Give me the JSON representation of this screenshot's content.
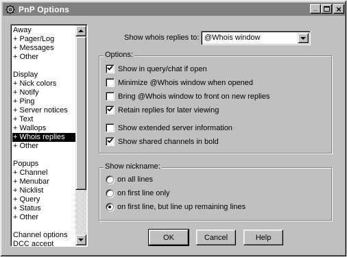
{
  "window": {
    "title": "PnP Options",
    "controls": {
      "minimize": "_",
      "maximize": "□",
      "close": "×"
    }
  },
  "sidebar": {
    "items": [
      {
        "label": "Away"
      },
      {
        "label": "+ Pager/Log"
      },
      {
        "label": "+ Messages"
      },
      {
        "label": "+ Other"
      },
      {
        "label": ""
      },
      {
        "label": "Display"
      },
      {
        "label": "+ Nick colors"
      },
      {
        "label": "+ Notify"
      },
      {
        "label": "+ Ping"
      },
      {
        "label": "+ Server notices"
      },
      {
        "label": "+ Text"
      },
      {
        "label": "+ Wallops"
      },
      {
        "label": "+ Whois replies",
        "selected": true
      },
      {
        "label": "+ Other"
      },
      {
        "label": ""
      },
      {
        "label": "Popups"
      },
      {
        "label": "+ Channel"
      },
      {
        "label": "+ Menubar"
      },
      {
        "label": "+ Nicklist"
      },
      {
        "label": "+ Query"
      },
      {
        "label": "+ Status"
      },
      {
        "label": "+ Other"
      },
      {
        "label": ""
      },
      {
        "label": "Channel options"
      },
      {
        "label": "DCC accept"
      }
    ]
  },
  "whois": {
    "show_label": "Show whois replies to:",
    "selected": "@Whois window"
  },
  "options": {
    "title": "Options:",
    "items": [
      {
        "label": "Show in query/chat if open",
        "checked": true
      },
      {
        "label": "Minimize @Whois window when opened",
        "checked": false
      },
      {
        "label": "Bring @Whois window to front on new replies",
        "checked": false
      },
      {
        "label": "Retain replies for later viewing",
        "checked": true
      },
      {
        "label": "Show extended server information",
        "checked": false
      },
      {
        "label": "Show shared channels in bold",
        "checked": true
      }
    ]
  },
  "nickname": {
    "title": "Show nickname:",
    "items": [
      {
        "label": "on all lines",
        "selected": false
      },
      {
        "label": "on first line only",
        "selected": false
      },
      {
        "label": "on first line, but line up remaining lines",
        "selected": true
      }
    ]
  },
  "buttons": {
    "ok": "OK",
    "cancel": "Cancel",
    "help": "Help"
  }
}
